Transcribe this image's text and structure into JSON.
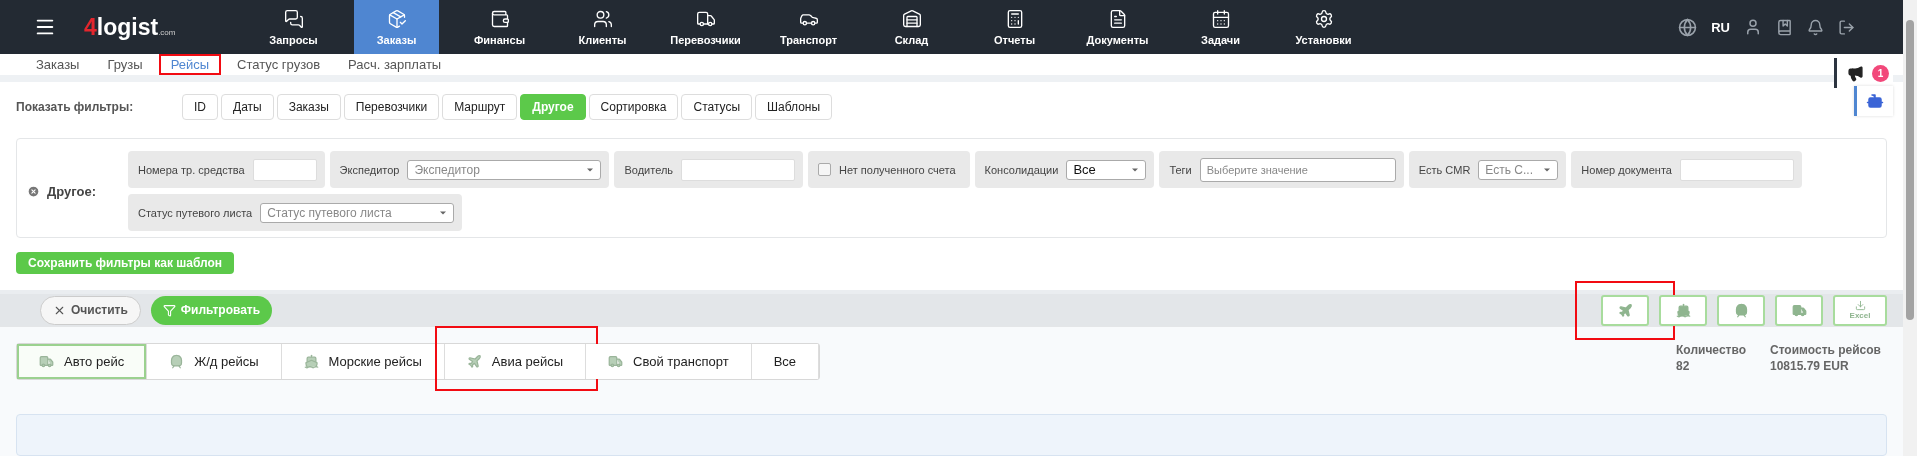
{
  "top_bar": {
    "logo": {
      "mark": "4",
      "name": "logist",
      "suffix": ".com"
    },
    "menu": [
      {
        "label": "Запросы",
        "selected": false
      },
      {
        "label": "Заказы",
        "selected": true
      },
      {
        "label": "Финансы",
        "selected": false
      },
      {
        "label": "Клиенты",
        "selected": false
      },
      {
        "label": "Перевозчики",
        "selected": false
      },
      {
        "label": "Транспорт",
        "selected": false
      },
      {
        "label": "Склад",
        "selected": false
      },
      {
        "label": "Отчеты",
        "selected": false
      },
      {
        "label": "Документы",
        "selected": false
      },
      {
        "label": "Задачи",
        "selected": false
      },
      {
        "label": "Установки",
        "selected": false
      }
    ],
    "language": "RU"
  },
  "sub_tabs": [
    {
      "label": "Заказы",
      "selected": false,
      "highlighted": false
    },
    {
      "label": "Грузы",
      "selected": false,
      "highlighted": false
    },
    {
      "label": "Рейсы",
      "selected": true,
      "highlighted": true
    },
    {
      "label": "Статус грузов",
      "selected": false,
      "highlighted": false
    },
    {
      "label": "Расч. зарплаты",
      "selected": false,
      "highlighted": false
    }
  ],
  "announcements": {
    "count": "1"
  },
  "filters": {
    "label": "Показать фильтры:",
    "buttons": [
      {
        "label": "ID",
        "selected": false
      },
      {
        "label": "Даты",
        "selected": false
      },
      {
        "label": "Заказы",
        "selected": false
      },
      {
        "label": "Перевозчики",
        "selected": false
      },
      {
        "label": "Маршрут",
        "selected": false
      },
      {
        "label": "Другое",
        "selected": true
      },
      {
        "label": "Сортировка",
        "selected": false
      },
      {
        "label": "Статусы",
        "selected": false
      },
      {
        "label": "Шаблоны",
        "selected": false
      }
    ],
    "panel": {
      "title": "Другое:",
      "fields": [
        {
          "kind": "text",
          "label": "Номера тр. средства"
        },
        {
          "kind": "select",
          "label": "Экспедитор",
          "placeholder": "Экспедитор"
        },
        {
          "kind": "text",
          "label": "Водитель"
        },
        {
          "kind": "checkbox",
          "label": "Нет полученного счета",
          "checked": false
        },
        {
          "kind": "select",
          "label": "Консолидации",
          "value": "Все"
        },
        {
          "kind": "tags",
          "label": "Теги",
          "placeholder": "Выберите значение"
        },
        {
          "kind": "select",
          "label": "Есть CMR",
          "placeholder": "Есть С..."
        },
        {
          "kind": "text",
          "label": "Номер документа"
        },
        {
          "kind": "select",
          "label": "Статус путевого листа",
          "placeholder": "Статус путевого листа"
        }
      ]
    },
    "save_template": "Сохранить фильтры как шаблон"
  },
  "toolbar": {
    "clear": "Очистить",
    "filter": "Фильтровать",
    "exports": [
      {
        "highlighted": true
      },
      {
        "highlighted": false
      },
      {
        "highlighted": false
      },
      {
        "highlighted": false
      },
      {
        "label": "Excel",
        "highlighted": false
      }
    ]
  },
  "trip_tabs": [
    {
      "label": "Авто рейс",
      "selected": true,
      "highlighted": false
    },
    {
      "label": "Ж/д рейсы",
      "selected": false,
      "highlighted": false
    },
    {
      "label": "Морские рейсы",
      "selected": false,
      "highlighted": false
    },
    {
      "label": "Авиа рейсы",
      "selected": false,
      "highlighted": true
    },
    {
      "label": "Свой транспорт",
      "selected": false,
      "highlighted": false
    },
    {
      "label": "Все",
      "selected": false,
      "highlighted": false
    }
  ],
  "summary": [
    {
      "label": "Количество",
      "value": "82"
    },
    {
      "label": "Стоимость рейсов",
      "value": "10815.79 EUR"
    }
  ]
}
